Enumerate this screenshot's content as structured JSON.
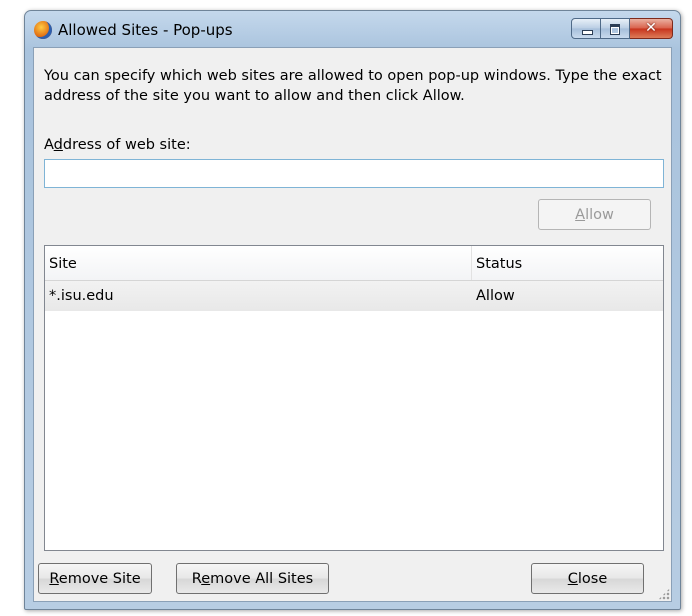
{
  "window": {
    "title": "Allowed Sites - Pop-ups",
    "controls": {
      "close_glyph": "✕"
    }
  },
  "description": "You can specify which web sites are allowed to open pop-up windows. Type the exact address of the site you want to allow and then click Allow.",
  "address": {
    "label_pre": "A",
    "label_accel": "d",
    "label_post": "dress of web site:",
    "value": "",
    "placeholder": ""
  },
  "allow_button": {
    "accel": "A",
    "rest": "llow",
    "enabled": false
  },
  "table": {
    "columns": [
      "Site",
      "Status"
    ],
    "rows": [
      {
        "site": "*.isu.edu",
        "status": "Allow"
      }
    ]
  },
  "buttons": {
    "remove_site": {
      "accel": "R",
      "rest": "emove Site"
    },
    "remove_all": {
      "pre": "R",
      "accel": "e",
      "rest": "move All Sites"
    },
    "close": {
      "accel": "C",
      "rest": "lose"
    }
  },
  "icons": {
    "app": "firefox-icon",
    "minimize": "minimize-icon",
    "maximize": "maximize-icon",
    "close": "close-icon",
    "grip": "resize-grip-icon"
  },
  "colors": {
    "title_bar": "#b7cde3",
    "close_button": "#c7331c",
    "input_border": "#7fb4d6",
    "row_selected": "#e8e8e8"
  }
}
